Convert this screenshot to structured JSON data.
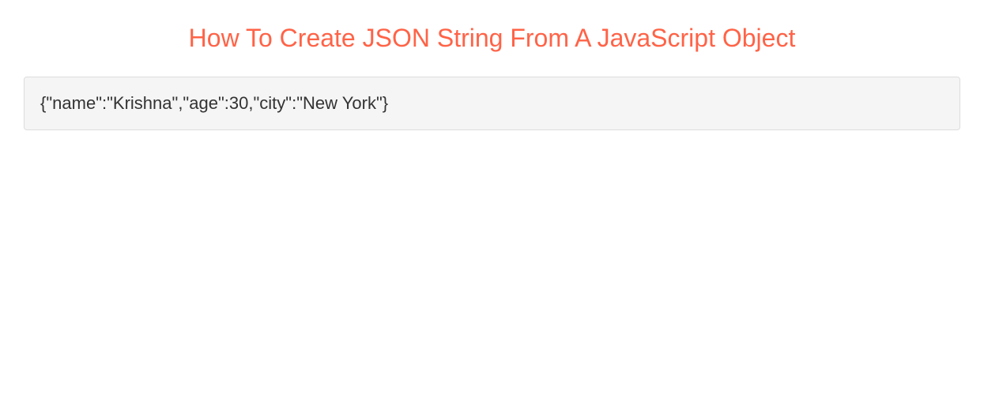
{
  "heading": "How To Create JSON String From A JavaScript Object",
  "code_output": "{\"name\":\"Krishna\",\"age\":30,\"city\":\"New York\"}"
}
